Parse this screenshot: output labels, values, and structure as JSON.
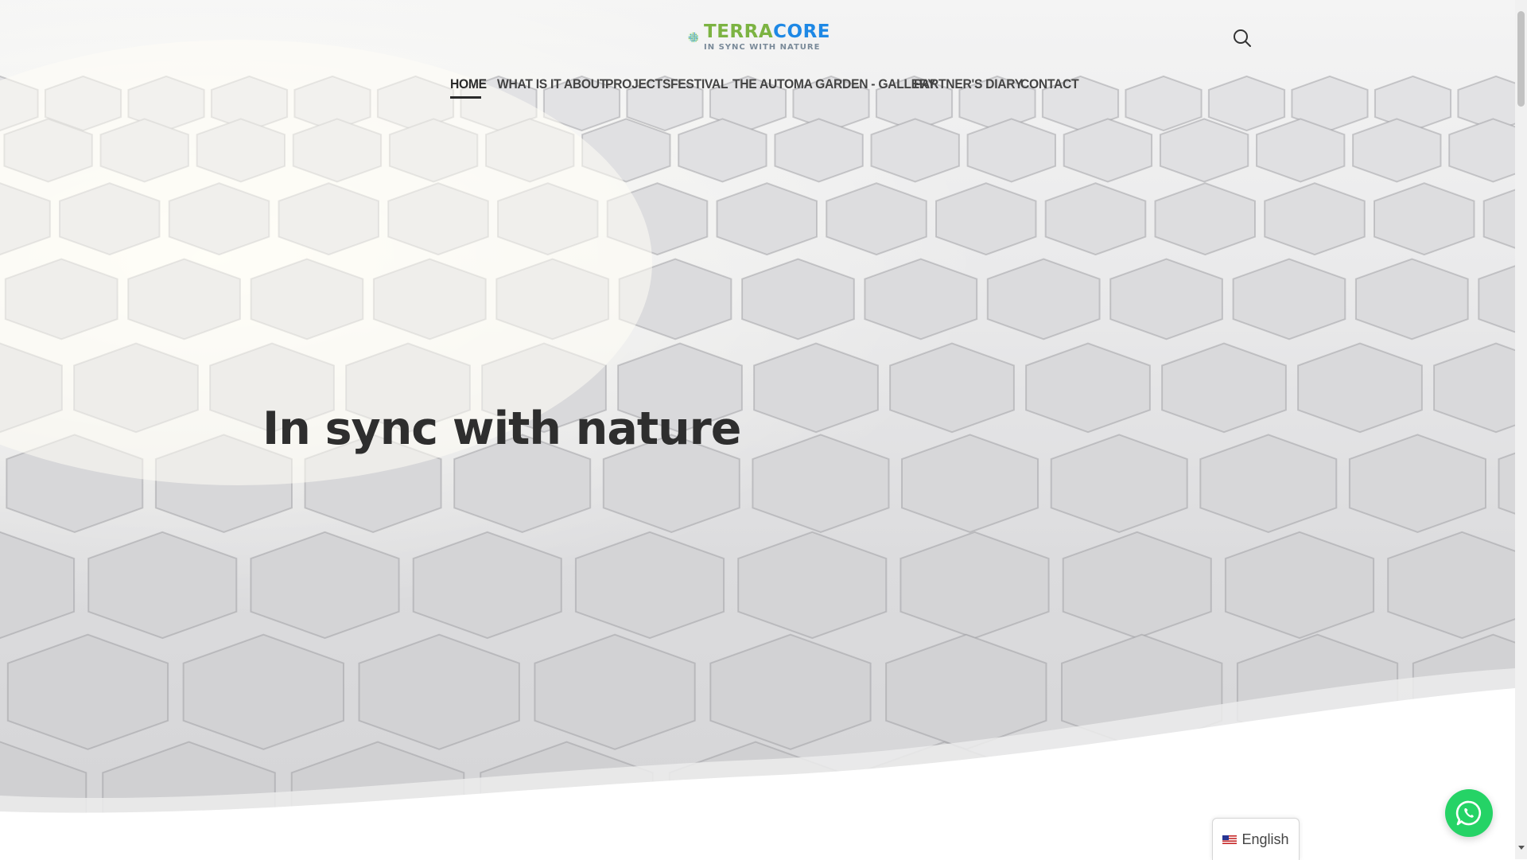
{
  "header": {
    "logo": {
      "name_part1": "TERRA",
      "name_part2": "CORE",
      "tagline": "IN SYNC WITH NATURE"
    },
    "search_icon": "search-icon"
  },
  "nav": {
    "items": [
      {
        "label": "HOME",
        "active": true
      },
      {
        "label": "WHAT IS IT ABOUT",
        "active": false
      },
      {
        "label": "PROJECTS",
        "active": false
      },
      {
        "label": "FESTIVAL",
        "active": false
      },
      {
        "label": "THE AUTOMA GARDEN - GALLERY",
        "active": false
      },
      {
        "label": "PARTNER'S DIARY",
        "active": false
      },
      {
        "label": "CONTACT",
        "active": false
      }
    ]
  },
  "hero": {
    "title": "In sync with nature"
  },
  "widgets": {
    "whatsapp_icon": "whatsapp-icon",
    "language": {
      "label": "English",
      "flag_icon": "us-flag-icon"
    }
  },
  "colors": {
    "brand_green": "#7cb342",
    "brand_blue": "#1e88e5",
    "whatsapp_green": "#25d366",
    "nav_text": "#444444"
  }
}
